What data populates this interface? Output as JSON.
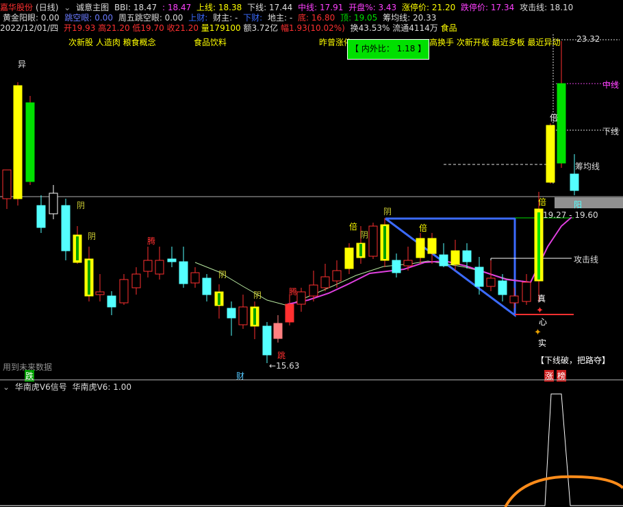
{
  "header": {
    "stock_name": "嘉华股份",
    "period": "(日线)",
    "indicator_title": "诚意主图",
    "bbi_label": "BBI: 18.47",
    "bbi_extra": ": 18.47",
    "upper_label": "上线: 18.38",
    "lower_label": "下线: 17.44",
    "mid_label": "中线: 17.91",
    "open_pct_label": "开盘%: 3.43",
    "limit_up_label": "涨停价: 21.20",
    "limit_down_label": "跌停价: 17.34",
    "attack_label": "攻击线: 18.10"
  },
  "row2": {
    "golden_yang": "黄金阳眼: 0.00",
    "jump_empty": "跳空眼: 0.00",
    "weekfive": "周五跳空眼: 0.00",
    "shang": "上财:",
    "caizhu": "财主: -",
    "xia": "下财:",
    "dizhu": "地主: -",
    "di": "底: 16.80",
    "ding": "顶: 19.05",
    "chouma": "筹均线: 20.33"
  },
  "row3": {
    "date": "2022/12/01/四",
    "open": "开19.93",
    "high": "高21.20",
    "low": "低19.70",
    "close": "收21.20",
    "vol": "量179100",
    "amount": "额3.72亿",
    "amp": "幅1.93(10.02%)",
    "turnover": "换43.53%",
    "float": "流通4114万",
    "sector": "食品"
  },
  "concepts": {
    "c1": "次新股 人造肉 粮食概念",
    "c2": "食品饮料",
    "c3": "昨曾涨停",
    "c4": "高换手 次新开板 最近多板 最近异动"
  },
  "popup": {
    "ratio": "【 内外比： 1.18 】"
  },
  "price_labels": {
    "top": "23.32",
    "range": "19.27 - 19.60",
    "bottom": "15.63",
    "zhongxian": "中线",
    "xiaxian": "下线",
    "choujunxian": "筹均线",
    "gongjixian": "攻击线",
    "yang": "阳"
  },
  "markers": {
    "yi": "异",
    "yin": "阴",
    "teng": "腾",
    "bei": "倍",
    "tiao": "跳",
    "zhen": "真",
    "xin": "心",
    "shi": "实",
    "die": "跌",
    "cai": "财",
    "zhang": "涨",
    "bang": "榜"
  },
  "notes": {
    "future": "用到未来数据",
    "breakline": "【下线破，把路夺】"
  },
  "subchart": {
    "title": "华南虎V6信号",
    "value": "华南虎V6: 1.00"
  },
  "colors": {
    "up": "#ff3030",
    "down": "#54ffff",
    "yellow": "#ffff00",
    "green": "#00e000",
    "magenta": "#e040e0",
    "blue": "#3b6bff"
  }
}
